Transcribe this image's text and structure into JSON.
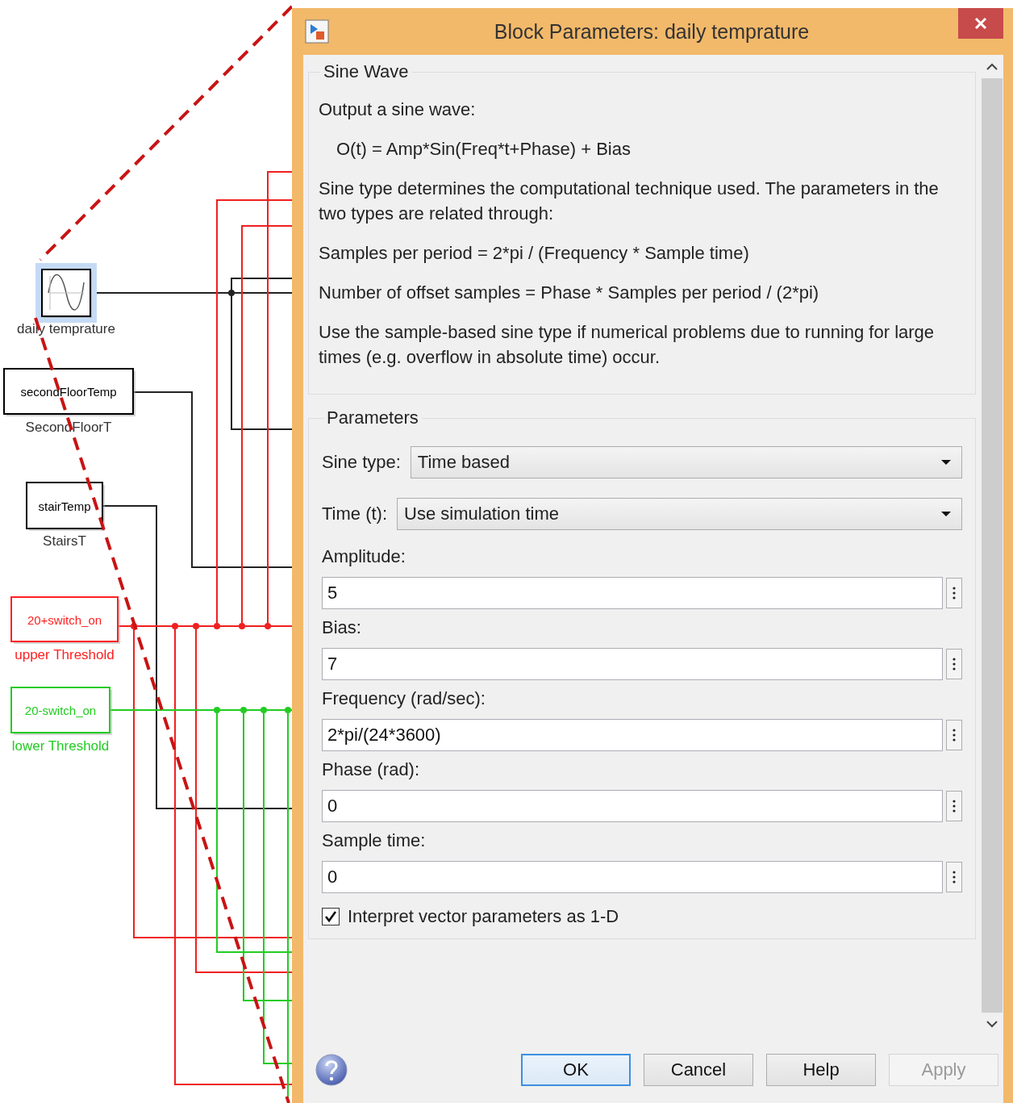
{
  "diagram": {
    "blocks": [
      {
        "kind": "sine",
        "label": "daily temprature",
        "selected": true,
        "color": "#000000"
      },
      {
        "kind": "box",
        "text": "secondFloorTemp",
        "label": "SecondFloorT",
        "selected": false,
        "color": "#000000"
      },
      {
        "kind": "box",
        "text": "stairTemp",
        "label": "StairsT",
        "selected": false,
        "color": "#000000"
      },
      {
        "kind": "box",
        "text": "20+switch_on",
        "label": "upper Threshold",
        "selected": false,
        "color": "#ff2020"
      },
      {
        "kind": "box",
        "text": "20-switch_on",
        "label": "lower Threshold",
        "selected": false,
        "color": "#22cc22"
      }
    ]
  },
  "dialog": {
    "title": "Block Parameters: daily temprature",
    "description": {
      "title": "Sine Wave",
      "paragraphs": [
        {
          "kind": "text",
          "text": "Output a sine wave:"
        },
        {
          "kind": "formula",
          "text": "O(t) = Amp*Sin(Freq*t+Phase) + Bias"
        },
        {
          "kind": "text",
          "text": "Sine type determines the computational technique used. The parameters in the two types are related through:"
        },
        {
          "kind": "text",
          "text": "Samples per period = 2*pi / (Frequency * Sample time)"
        },
        {
          "kind": "text",
          "text": "Number of offset samples = Phase * Samples per period / (2*pi)"
        },
        {
          "kind": "text",
          "text": "Use the sample-based sine type if numerical problems due to running for large times (e.g. overflow in absolute time) occur."
        }
      ]
    },
    "parameters": {
      "title": "Parameters",
      "fields": [
        {
          "kind": "dropdown",
          "label": "Sine type:",
          "value": "Time based"
        },
        {
          "kind": "dropdown",
          "label": "Time (t):",
          "value": "Use simulation time"
        },
        {
          "kind": "text",
          "label": "Amplitude:",
          "value": "5"
        },
        {
          "kind": "text",
          "label": "Bias:",
          "value": "7"
        },
        {
          "kind": "text",
          "label": "Frequency (rad/sec):",
          "value": "2*pi/(24*3600)"
        },
        {
          "kind": "text",
          "label": "Phase (rad):",
          "value": "0"
        },
        {
          "kind": "text",
          "label": "Sample time:",
          "value": "0"
        }
      ],
      "checkbox": {
        "label": "Interpret vector parameters as 1-D",
        "checked": true
      }
    },
    "buttons": [
      {
        "label": "OK",
        "default": true,
        "disabled": false
      },
      {
        "label": "Cancel",
        "default": false,
        "disabled": false
      },
      {
        "label": "Help",
        "default": false,
        "disabled": false
      },
      {
        "label": "Apply",
        "default": false,
        "disabled": true
      }
    ]
  }
}
